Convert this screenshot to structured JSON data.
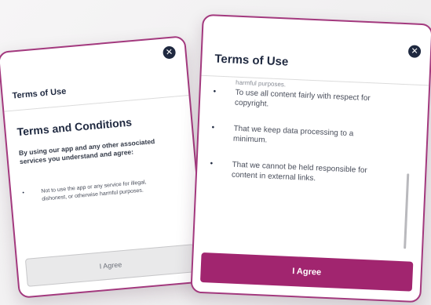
{
  "colors": {
    "accent": "#a1256f",
    "border": "#a3397e",
    "text_dark": "#1f2940"
  },
  "left_card": {
    "title": "Terms of Use",
    "close_icon": "close-icon",
    "heading": "Terms and Conditions",
    "intro": "By using our app and any other associated services you understand and agree:",
    "bullets": [
      "Not to use the app or any service for illegal, dishonest, or otherwise harmful purposes."
    ],
    "agree_label": "I Agree"
  },
  "right_card": {
    "title": "Terms of Use",
    "close_icon": "close-icon",
    "faded_text": "harmful purposes.",
    "bullets": [
      "To use all content fairly with respect for copyright.",
      "That we keep data processing to a minimum.",
      "That we cannot be held responsible for content in external links."
    ],
    "agree_label": "I Agree"
  }
}
